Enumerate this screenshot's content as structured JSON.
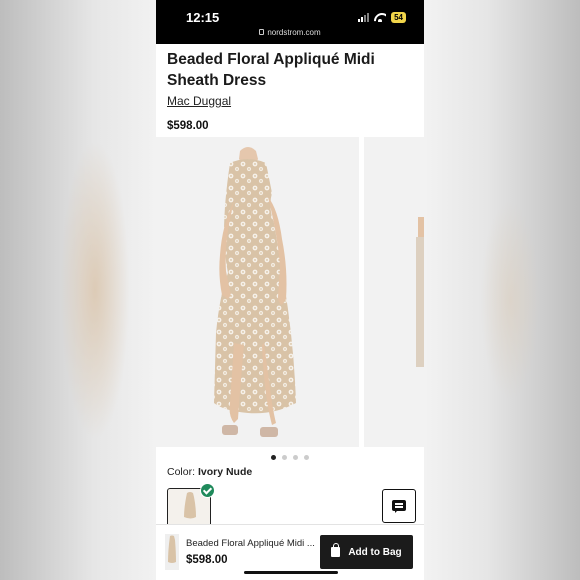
{
  "status_bar": {
    "time": "12:15",
    "url": "nordstrom.com",
    "battery": "54",
    "battery_color": "#f1d54a"
  },
  "product": {
    "title": "Beaded Floral Appliqué Midi Sheath Dress",
    "brand": "Mac Duggal",
    "price": "$598.00"
  },
  "gallery": {
    "images": [
      {
        "icon": "dress-front-photo"
      },
      {
        "icon": "dress-partial-photo"
      }
    ],
    "dots": [
      true,
      false,
      false,
      false
    ]
  },
  "color": {
    "label": "Color: ",
    "value": "Ivory Nude",
    "selected_check_color": "#1f8a5b"
  },
  "chat": {
    "icon": "chat-icon"
  },
  "bottom_bar": {
    "name": "Beaded Floral Appliqué Midi ...",
    "price": "$598.00",
    "add_to_bag_label": "Add to Bag"
  }
}
